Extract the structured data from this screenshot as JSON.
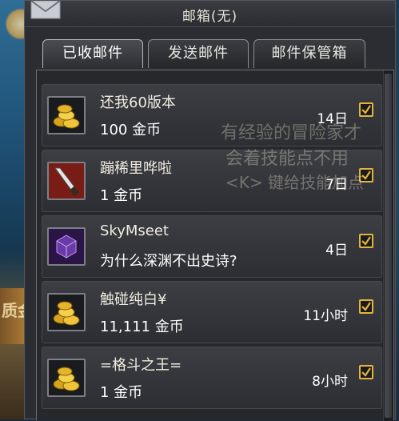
{
  "window": {
    "title": "邮箱(无)"
  },
  "tabs": [
    {
      "label": "已收邮件",
      "active": true
    },
    {
      "label": "发送邮件",
      "active": false
    },
    {
      "label": "邮件保管箱",
      "active": false
    }
  ],
  "mails": [
    {
      "sender": "还我60版本",
      "desc": "100 金币",
      "time": "14日",
      "icon": "gold-coins-icon",
      "checked": true
    },
    {
      "sender": "蹦稀里哗啦",
      "desc": "1 金币",
      "time": "7日",
      "icon": "dagger-icon",
      "checked": true
    },
    {
      "sender": "SkyMseet",
      "desc": "为什么深渊不出史诗?",
      "time": "4日",
      "icon": "purple-cube-icon",
      "checked": true
    },
    {
      "sender": "触碰纯白¥",
      "desc": "11,111 金币",
      "time": "11小时",
      "icon": "gold-coins-icon",
      "checked": true
    },
    {
      "sender": "=格斗之王=",
      "desc": "1 金币",
      "time": "8小时",
      "icon": "gold-coins-icon",
      "checked": true
    }
  ],
  "overlay_hint": {
    "line1": "有经验的冒险家才",
    "line2": "会着技能点不用",
    "line3": "<K> 键给技能加点"
  },
  "background_text": "质金",
  "colors": {
    "check_border": "#e2b53a",
    "window_bg": "#2b2d33"
  }
}
